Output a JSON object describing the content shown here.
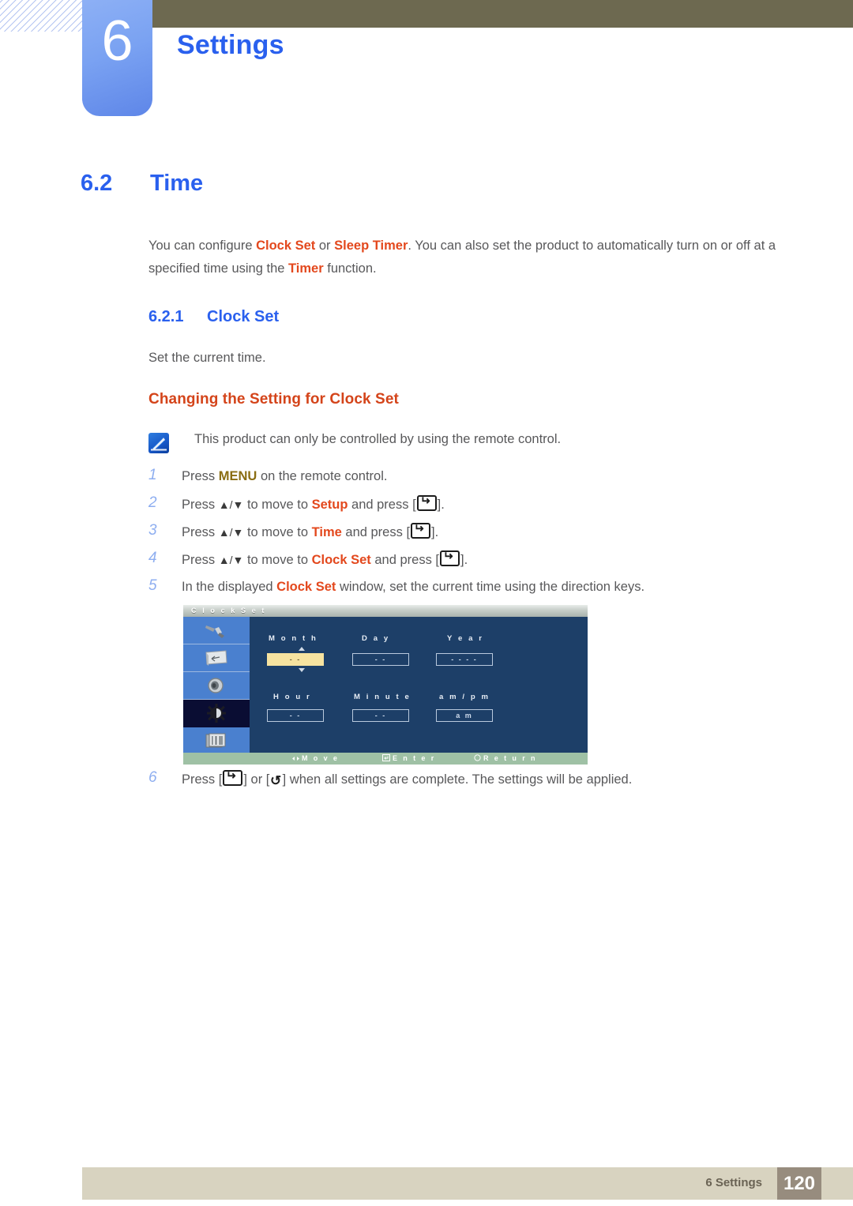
{
  "chapter": {
    "number": "6",
    "title": "Settings"
  },
  "section": {
    "number": "6.2",
    "title": "Time"
  },
  "intro": {
    "part1": "You can configure ",
    "hl1": "Clock Set",
    "part2": " or ",
    "hl2": "Sleep Timer",
    "part3": ". You can also set the product to automatically turn on or off at a specified time using the ",
    "hl3": "Timer",
    "part4": " function."
  },
  "subsection": {
    "number": "6.2.1",
    "title": "Clock Set",
    "lead": "Set the current time."
  },
  "orange_heading": "Changing the Setting for Clock Set",
  "note": {
    "icon": "note-pen-icon",
    "text": "This product can only be controlled by using the remote control."
  },
  "steps": [
    {
      "number": "1",
      "pre": "Press ",
      "key": "MENU",
      "post": " on the remote control."
    },
    {
      "number": "2",
      "pre": "Press ",
      "arrows": "▲/▼",
      "mid": " to move to ",
      "target": "Setup",
      "post": " and press [",
      "tail": "]."
    },
    {
      "number": "3",
      "pre": "Press ",
      "arrows": "▲/▼",
      "mid": " to move to ",
      "target": "Time",
      "post": " and press [",
      "tail": "]."
    },
    {
      "number": "4",
      "pre": "Press ",
      "arrows": "▲/▼",
      "mid": " to move to ",
      "target": "Clock Set",
      "post": " and press [",
      "tail": "]."
    },
    {
      "number": "5",
      "pre": "In the displayed ",
      "target": "Clock Set",
      "post": " window, set the current time using the direction keys."
    },
    {
      "number": "6",
      "pre": "Press [",
      "mid": "] or [",
      "post": "] when all settings are complete. The settings will be applied."
    }
  ],
  "osd": {
    "title": "C l o c k   S e t",
    "sidebar_icons": [
      {
        "name": "picture-tool-icon",
        "selected": false
      },
      {
        "name": "screen-adjust-icon",
        "selected": false
      },
      {
        "name": "sound-speaker-icon",
        "selected": false
      },
      {
        "name": "setup-gear-icon",
        "selected": true
      },
      {
        "name": "multi-control-icon",
        "selected": false
      }
    ],
    "fields": [
      {
        "label": "M o n t h",
        "value": "- -",
        "active": true
      },
      {
        "label": "D a y",
        "value": "- -",
        "active": false
      },
      {
        "label": "Y e a r",
        "value": "- - - -",
        "active": false
      },
      {
        "label": "H o u r",
        "value": "- -",
        "active": false
      },
      {
        "label": "M i n u t e",
        "value": "- -",
        "active": false
      },
      {
        "label": "a m / p m",
        "value": "a m",
        "active": false
      }
    ],
    "footer": [
      {
        "icon": "move-icon",
        "label": "M o v e"
      },
      {
        "icon": "enter-icon",
        "label": "E n t e r"
      },
      {
        "icon": "return-icon",
        "label": "R e t u r n"
      }
    ]
  },
  "footer": {
    "label": "6 Settings",
    "page": "120"
  },
  "colors": {
    "accent_blue": "#2a60ee",
    "highlight_orange": "#e3481d",
    "menu_gold": "#8a6d12",
    "topbar_olive": "#6d6950",
    "footer_beige": "#d8d3c0",
    "page_box": "#978c7e",
    "osd_blue": "#1d3f68",
    "osd_active_yellow": "#f6e3a0",
    "osd_footer_green": "#9fc1a5"
  }
}
